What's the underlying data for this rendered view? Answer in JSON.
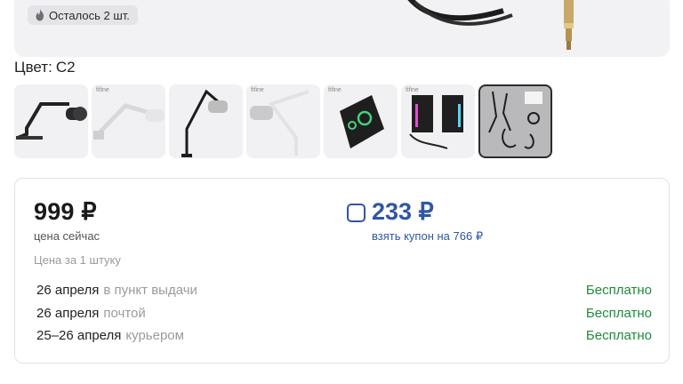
{
  "hero": {
    "stock_badge": "Осталось 2 шт."
  },
  "variant": {
    "label": "Цвет:",
    "value": "C2"
  },
  "thumbnails": [
    {
      "name": "thumb-black-boom-arm",
      "brand": ""
    },
    {
      "name": "thumb-white-boom-arm",
      "brand": "fifine"
    },
    {
      "name": "thumb-black-arm-with-mic",
      "brand": ""
    },
    {
      "name": "thumb-white-arm-with-mic",
      "brand": "fifine"
    },
    {
      "name": "thumb-audio-mixer",
      "brand": "fifine"
    },
    {
      "name": "thumb-rgb-speakers",
      "brand": "fifine"
    },
    {
      "name": "thumb-accessories-kit",
      "brand": ""
    }
  ],
  "pricing": {
    "current_price": "999 ₽",
    "current_caption": "цена сейчас",
    "coupon_price": "233 ₽",
    "coupon_link": "взять купон на 766 ₽",
    "unit_note": "Цена за 1 штуку"
  },
  "delivery": [
    {
      "date": "26 апреля",
      "method": "в пункт выдачи",
      "cost": "Бесплатно"
    },
    {
      "date": "26 апреля",
      "method": "почтой",
      "cost": "Бесплатно"
    },
    {
      "date": "25–26 апреля",
      "method": "курьером",
      "cost": "Бесплатно"
    }
  ],
  "colors": {
    "accent": "#2f56a6",
    "free_delivery": "#1f8a3b",
    "muted_text": "#9b9b9b"
  }
}
